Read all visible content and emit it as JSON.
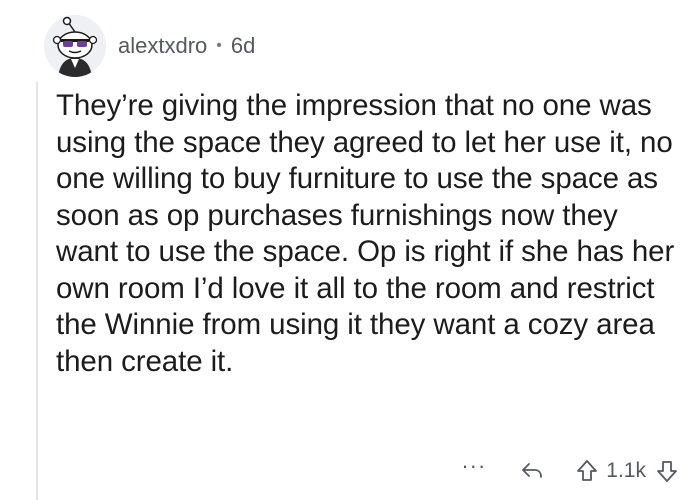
{
  "comment": {
    "username": "alextxdro",
    "separator": "•",
    "age": "6d",
    "text": "They’re giving the impression that no one was using the space they agreed to let her use it, no one willing to buy furniture to use the space as soon as op purchases furnishings now they want to use the space. Op is right if she has her own room I’d love it all to the room and restrict the Winnie from using it they want a cozy area then create it."
  },
  "actions": {
    "more_label": "···",
    "score": "1.1k",
    "icons": [
      "more-options-icon",
      "reply-arrow-icon",
      "upvote-arrow-icon",
      "downvote-arrow-icon"
    ]
  },
  "colors": {
    "meta_text": "#555a60",
    "body_text": "#1c1c1c",
    "thread_line": "#e4e4e6"
  }
}
